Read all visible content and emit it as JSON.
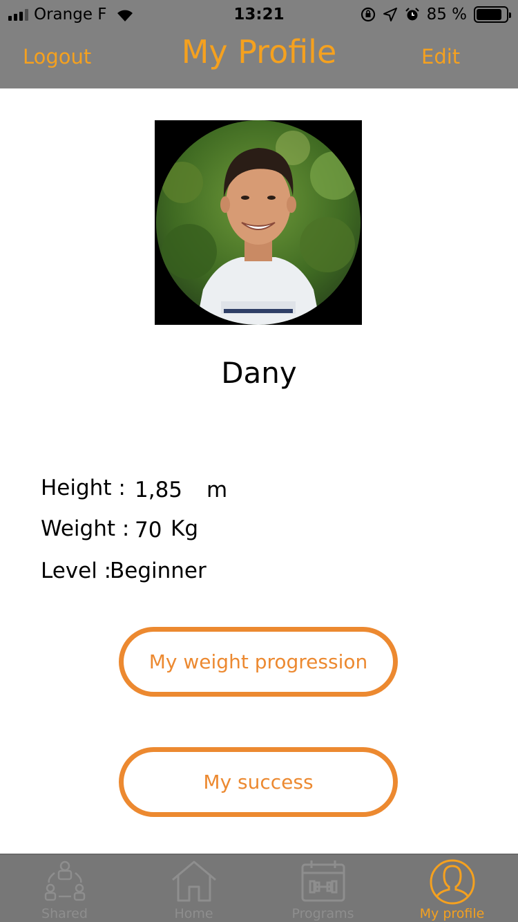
{
  "status_bar": {
    "carrier": "Orange F",
    "time": "13:21",
    "battery_percent": "85 %",
    "battery_level": 0.85,
    "icons": [
      "signal-icon",
      "wifi-icon",
      "orientation-lock-icon",
      "location-icon",
      "alarm-icon",
      "battery-icon"
    ]
  },
  "nav": {
    "logout_label": "Logout",
    "title": "My Profile",
    "edit_label": "Edit"
  },
  "profile": {
    "name": "Dany",
    "height_label": "Height :",
    "height_value": "1,85",
    "height_unit": "m",
    "weight_label": "Weight :",
    "weight_value": "70",
    "weight_unit": "Kg",
    "level_label": "Level :",
    "level_value": "Beginner"
  },
  "buttons": {
    "weight_progression": "My weight progression",
    "success": "My success"
  },
  "tabbar": {
    "tabs": [
      {
        "label": "Shared",
        "icon": "shared-people-icon"
      },
      {
        "label": "Home",
        "icon": "home-icon"
      },
      {
        "label": "Programs",
        "icon": "calendar-dumbbell-icon"
      },
      {
        "label": "My profile",
        "icon": "profile-person-icon",
        "active": true
      }
    ]
  },
  "colors": {
    "accent": "#f5a11f",
    "button_border": "#ec8930",
    "header_bg": "#818181",
    "tabbar_bg": "#777777",
    "tab_inactive": "#8e8e8e"
  }
}
